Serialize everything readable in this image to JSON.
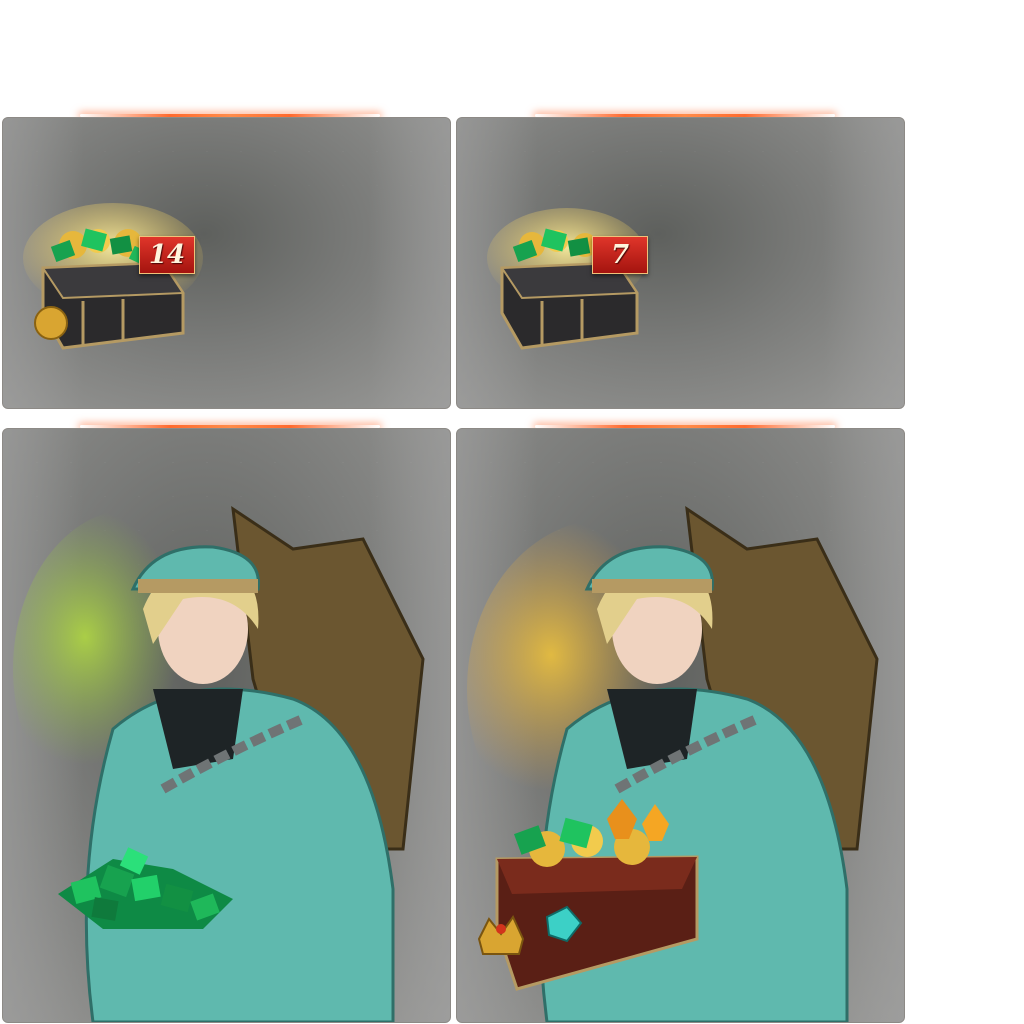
{
  "cards": [
    {
      "name": "emerald-chest-14",
      "badge": "14",
      "accent": "#ff6a2e"
    },
    {
      "name": "emerald-chest-7",
      "badge": "7",
      "accent": "#ff6a2e"
    },
    {
      "name": "character-emerald-pile"
    },
    {
      "name": "character-treasure-chest"
    }
  ],
  "colors": {
    "emerald": "#1fae5a",
    "gold": "#e2b43a",
    "coat": "#5fb9ae",
    "hair": "#e2cf8c"
  }
}
